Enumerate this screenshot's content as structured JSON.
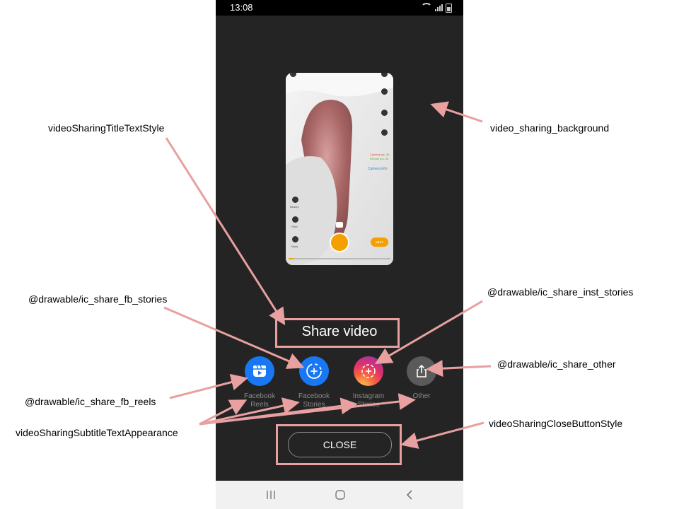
{
  "status_bar": {
    "time": "13:08"
  },
  "preview": {
    "overlay_lines": [
      "Camera fps: 30",
      "Render fps: 30",
      "Camera Info"
    ],
    "side_buttons": [
      "Beauty",
      "Filter",
      "Mask"
    ],
    "next_label": "NEXT",
    "progress": 0.05
  },
  "dialog": {
    "title": "Share video",
    "options": [
      {
        "label": "Facebook\nReels",
        "icon": "fb-reels-icon",
        "color": "#1877f2"
      },
      {
        "label": "Facebook\nStories",
        "icon": "fb-stories-icon",
        "color": "#1877f2"
      },
      {
        "label": "Instagram\nStories",
        "icon": "instagram-stories-icon",
        "color": "#e4405f"
      },
      {
        "label": "Other",
        "icon": "share-icon",
        "color": "#5a5a5a"
      }
    ],
    "close_label": "CLOSE"
  },
  "annotations": {
    "title_style": "videoSharingTitleTextStyle",
    "background": "video_sharing_background",
    "fb_stories": "@drawable/ic_share_fb_stories",
    "inst_stories": "@drawable/ic_share_inst_stories",
    "share_other": "@drawable/ic_share_other",
    "fb_reels": "@drawable/ic_share_fb_reels",
    "subtitle_appearance": "videoSharingSubtitleTextAppearance",
    "close_button_style": "videoSharingCloseButtonStyle"
  }
}
